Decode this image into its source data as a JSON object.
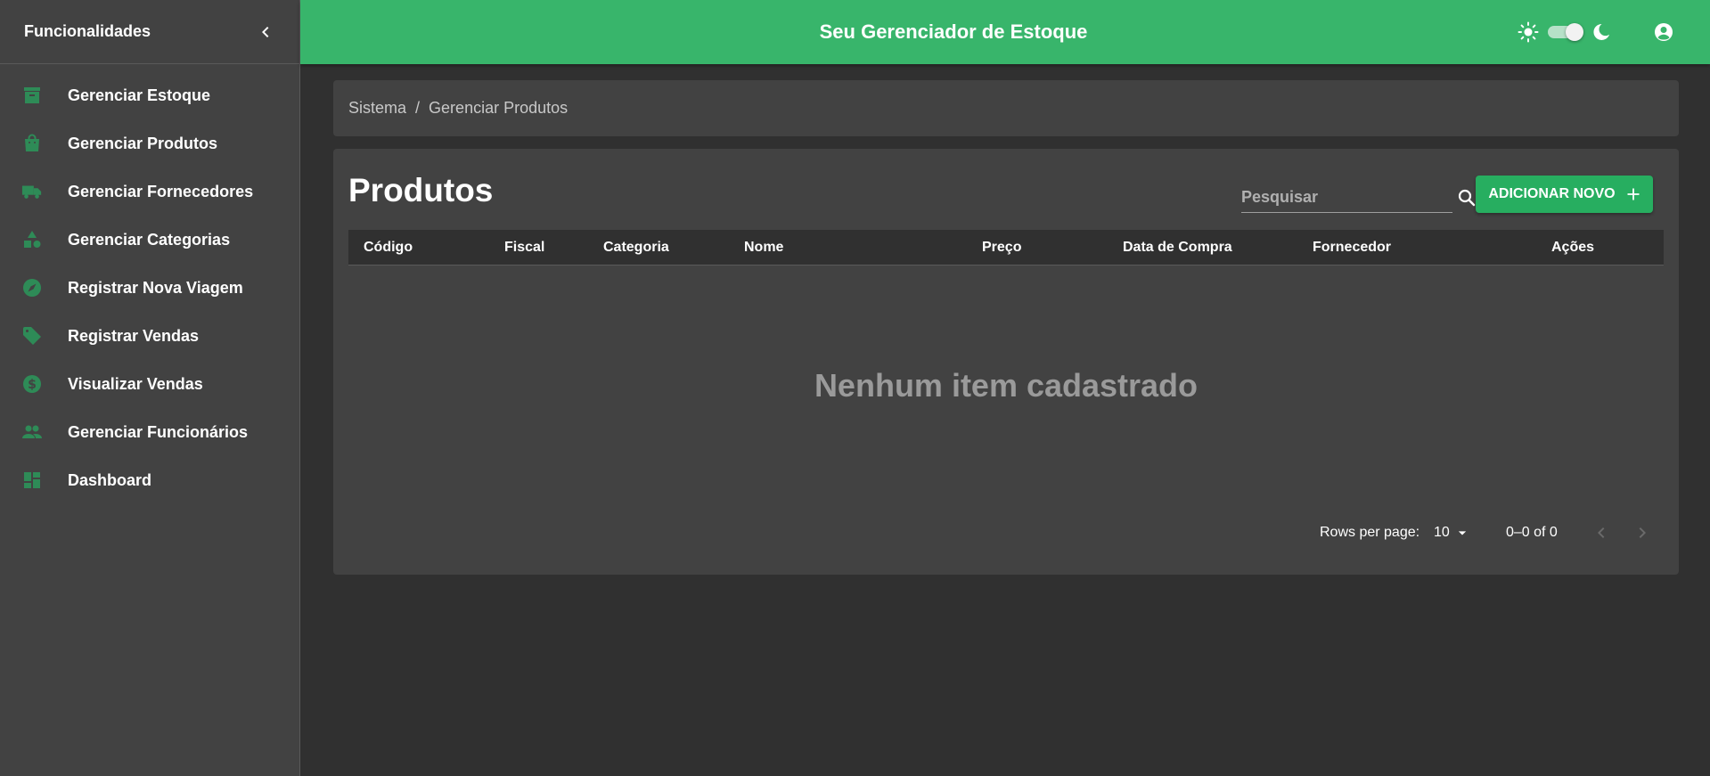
{
  "sidebar": {
    "title": "Funcionalidades",
    "items": [
      {
        "label": "Gerenciar Estoque",
        "icon": "archive-icon"
      },
      {
        "label": "Gerenciar Produtos",
        "icon": "shopping-bag-icon"
      },
      {
        "label": "Gerenciar Fornecedores",
        "icon": "truck-icon"
      },
      {
        "label": "Gerenciar Categorias",
        "icon": "shapes-icon"
      },
      {
        "label": "Registrar Nova Viagem",
        "icon": "compass-icon"
      },
      {
        "label": "Registrar Vendas",
        "icon": "tag-icon"
      },
      {
        "label": "Visualizar Vendas",
        "icon": "dollar-circle-icon"
      },
      {
        "label": "Gerenciar Funcionários",
        "icon": "people-icon"
      },
      {
        "label": "Dashboard",
        "icon": "dashboard-icon"
      }
    ]
  },
  "header": {
    "title": "Seu Gerenciador de Estoque",
    "theme_toggle_on": true
  },
  "breadcrumb": {
    "items": [
      "Sistema",
      "Gerenciar Produtos"
    ],
    "separator": "/"
  },
  "main": {
    "title": "Produtos",
    "search": {
      "placeholder": "Pesquisar",
      "value": ""
    },
    "add_button": "ADICIONAR NOVO",
    "columns": [
      "Código",
      "Fiscal",
      "Categoria",
      "Nome",
      "Preço",
      "Data de Compra",
      "Fornecedor",
      "Ações"
    ],
    "empty_message": "Nenhum item cadastrado",
    "pagination": {
      "rows_per_page_label": "Rows per page:",
      "rows_per_page": "10",
      "range": "0–0 of 0"
    }
  },
  "colors": {
    "accent": "#38b56b",
    "button": "#27ae60",
    "icon": "#2e8b57",
    "panel": "#424242",
    "background": "#303030"
  }
}
